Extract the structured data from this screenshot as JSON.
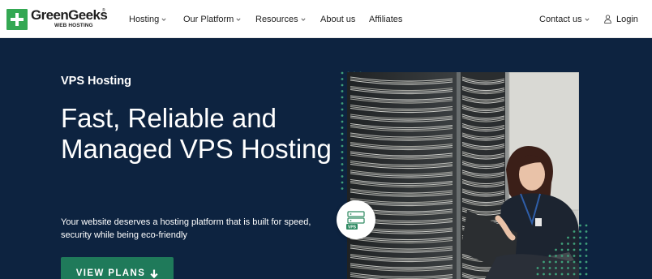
{
  "brand": {
    "name": "GreenGeeks",
    "registered": "®",
    "tagline": "WEB HOSTING",
    "icon": "plus-icon",
    "color": "#34a853"
  },
  "nav": {
    "items": [
      {
        "label": "Hosting",
        "has_dropdown": true
      },
      {
        "label": "Our Platform",
        "has_dropdown": true
      },
      {
        "label": "Resources",
        "has_dropdown": true
      },
      {
        "label": "About us",
        "has_dropdown": false
      },
      {
        "label": "Affiliates",
        "has_dropdown": false
      }
    ],
    "contact": {
      "label": "Contact us",
      "has_dropdown": true
    },
    "login": {
      "label": "Login",
      "icon": "user-icon"
    }
  },
  "hero": {
    "background": "#0d2340",
    "eyebrow": "VPS Hosting",
    "headline": "Fast, Reliable and Managed VPS Hosting",
    "subtext": "Your website deserves a hosting platform that is built for speed, security while being eco-friendly",
    "cta": {
      "label": "VIEW PLANS",
      "icon": "arrow-down-icon",
      "color": "#1f7a5a"
    },
    "image": {
      "subject": "server-room-photo"
    },
    "badge": {
      "label": "VPS",
      "icon": "vps-server-icon"
    },
    "dot_color": "#3fa07a"
  }
}
